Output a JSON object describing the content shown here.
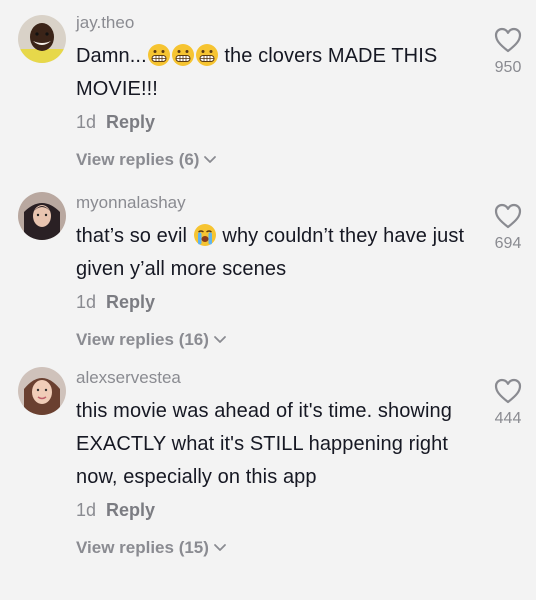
{
  "comments": [
    {
      "username": "jay.theo",
      "text_before": "Damn...",
      "emojis": [
        "grimacing-face-emoji",
        "grimacing-face-emoji",
        "grimacing-face-emoji"
      ],
      "text_after": " the clovers MADE THIS MOVIE!!!",
      "time": "1d",
      "reply_label": "Reply",
      "view_replies": "View replies (6)",
      "likes": "950"
    },
    {
      "username": "myonnalashay",
      "text_before": "that’s so evil ",
      "emojis": [
        "loudly-crying-face-emoji"
      ],
      "text_after": " why couldn’t they have just given y’all more scenes",
      "time": "1d",
      "reply_label": "Reply",
      "view_replies": "View replies (16)",
      "likes": "694"
    },
    {
      "username": "alexservestea",
      "text_before": "this movie was ahead of it's time. showing EXACTLY what it's STILL happening right now, especially on this app",
      "emojis": [],
      "text_after": "",
      "time": "1d",
      "reply_label": "Reply",
      "view_replies": "View replies (15)",
      "likes": "444"
    }
  ],
  "colors": {
    "background": "#f3f3f3",
    "text": "#161823",
    "muted": "#8a8b91"
  }
}
